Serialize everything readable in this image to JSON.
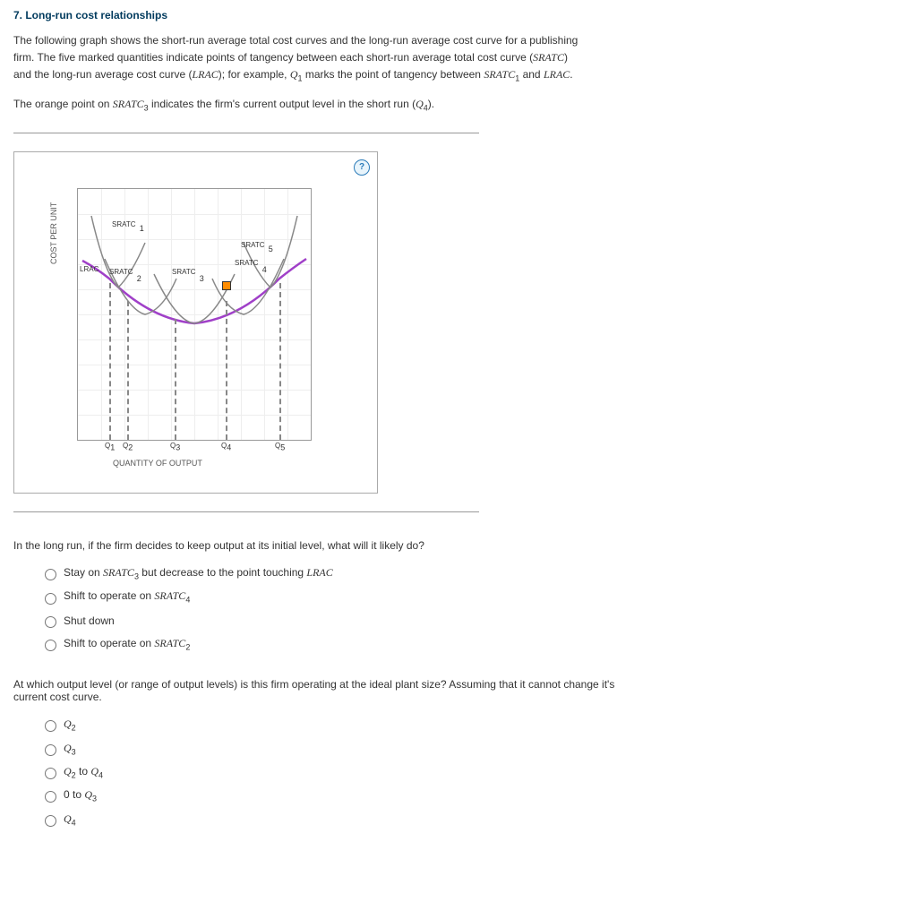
{
  "title": "7. Long-run cost relationships",
  "paragraph1": "The following graph shows the short-run average total cost curves and the long-run average cost curve for a publishing firm. The five marked quantities indicate points of tangency between each short-run average total cost curve (SRATC) and the long-run average cost curve (LRAC); for example, Q1 marks the point of tangency between SRATC1 and LRAC.",
  "paragraph2": "The orange point on SRATC3 indicates the firm's current output level in the short run (Q4).",
  "help": "?",
  "chart": {
    "ylabel": "COST PER UNIT",
    "xlabel": "QUANTITY OF OUTPUT",
    "labels": {
      "sratc1": "SRATC",
      "sratc2": "SRATC",
      "sratc3": "SRATC",
      "sratc4": "SRATC",
      "sratc5": "SRATC",
      "lrac": "LRAC",
      "sub1": "1",
      "sub2": "2",
      "sub3": "3",
      "sub4": "4",
      "sub5": "5"
    },
    "ticks": {
      "q1": "Q",
      "s1": "1",
      "q2": "Q",
      "s2": "2",
      "q3": "Q",
      "s3": "3",
      "q4": "Q",
      "s4": "4",
      "q5": "Q",
      "s5": "5"
    }
  },
  "question1": "In the long run, if the firm decides to keep output at its initial level, what will it likely do?",
  "q1_options": {
    "a": "Stay on SRATC3 but decrease to the point touching LRAC",
    "b": "Shift to operate on SRATC4",
    "c": "Shut down",
    "d": "Shift to operate on SRATC2"
  },
  "question2": "At which output level (or range of output levels) is this firm operating at the ideal plant size? Assuming that it cannot change it's current cost curve.",
  "q2_options": {
    "a": "Q2",
    "b": "Q3",
    "c": "Q2 to Q4",
    "d": "0 to Q3",
    "e": "Q4"
  },
  "chart_data": {
    "type": "line",
    "title": "Short-run and long-run average cost curves",
    "xlabel": "Quantity of Output",
    "ylabel": "Cost per Unit",
    "x_ticks": [
      "Q1",
      "Q2",
      "Q3",
      "Q4",
      "Q5"
    ],
    "series": [
      {
        "name": "LRAC",
        "shape": "u-shape",
        "tangent_points": [
          "Q1",
          "Q2",
          "Q3",
          "Q4",
          "Q5"
        ],
        "min_at": "Q3"
      },
      {
        "name": "SRATC1",
        "tangent_at": "Q1"
      },
      {
        "name": "SRATC2",
        "tangent_at": "Q2"
      },
      {
        "name": "SRATC3",
        "tangent_at": "Q3",
        "current_output_marker": "Q4"
      },
      {
        "name": "SRATC4",
        "tangent_at": "Q4"
      },
      {
        "name": "SRATC5",
        "tangent_at": "Q5"
      }
    ]
  }
}
